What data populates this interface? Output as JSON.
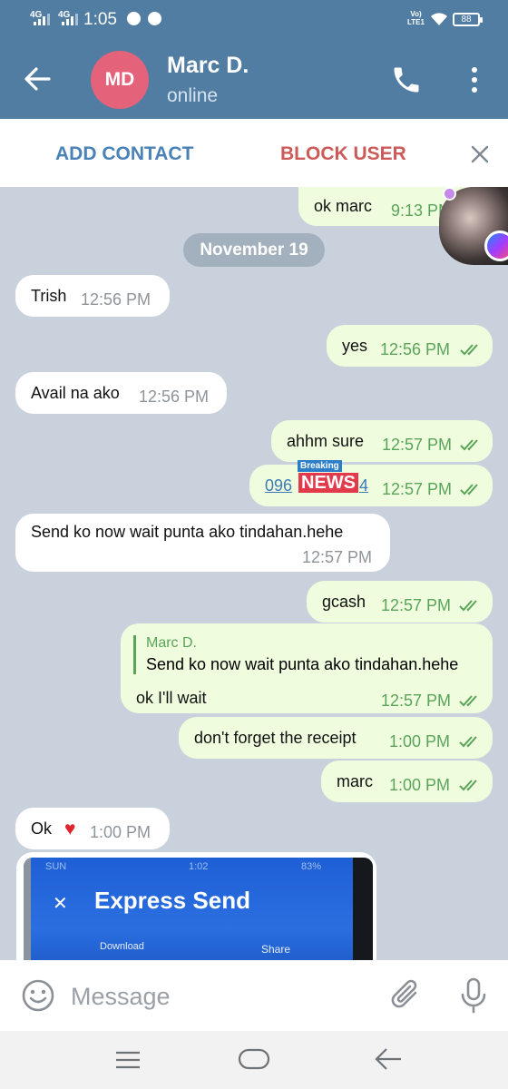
{
  "status_bar": {
    "network_1": "4G",
    "network_2": "4G",
    "time": "1:05",
    "volte": "Vo)",
    "lte": "LTE1",
    "battery": "88"
  },
  "header": {
    "avatar_initials": "MD",
    "avatar_color": "#e4637a",
    "name": "Marc D.",
    "status": "online"
  },
  "action_bar": {
    "add_contact": "ADD CONTACT",
    "block_user": "BLOCK USER"
  },
  "chat": {
    "date_separator": "November 19",
    "messages": [
      {
        "dir": "out",
        "text": "ok marc",
        "time": "9:13 PM"
      },
      {
        "dir": "in",
        "text": "Trish",
        "time": "12:56 PM"
      },
      {
        "dir": "out",
        "text": "yes",
        "time": "12:56 PM"
      },
      {
        "dir": "in",
        "text": "Avail na ako",
        "time": "12:56 PM"
      },
      {
        "dir": "out",
        "text": "ahhm sure",
        "time": "12:57 PM"
      },
      {
        "dir": "out",
        "text_start": "096",
        "text_end": "4",
        "time": "12:57 PM"
      },
      {
        "dir": "in",
        "text": "Send ko now wait punta ako tindahan.hehe",
        "time": "12:57 PM"
      },
      {
        "dir": "out",
        "text": "gcash",
        "time": "12:57 PM"
      },
      {
        "dir": "out",
        "reply_to_name": "Marc D.",
        "reply_to_text": "Send ko now wait punta ako tindahan.hehe",
        "text": "ok I'll wait",
        "time": "12:57 PM"
      },
      {
        "dir": "out",
        "text": "don't forget the receipt",
        "time": "1:00 PM"
      },
      {
        "dir": "out",
        "text": "marc",
        "time": "1:00 PM"
      },
      {
        "dir": "in",
        "text": "Ok",
        "emoji": "♥",
        "time": "1:00 PM"
      }
    ],
    "overlay_sticker": {
      "tag": "Breaking",
      "word": "NEWS"
    },
    "photo": {
      "status_time": "1:02",
      "status_left": "SUN",
      "status_right": "83%",
      "title": "Express Send",
      "download": "Download",
      "share": "Share"
    }
  },
  "input": {
    "placeholder": "Message"
  },
  "colors": {
    "header_bg": "#517da2",
    "chat_bg": "#c9d1dc",
    "outgoing_bubble": "#effdde",
    "incoming_bubble": "#ffffff",
    "read_ticks": "#5aa45a",
    "add_contact": "#4a82b8",
    "block_user": "#cc5a5a"
  },
  "icons": [
    "back-arrow-icon",
    "phone-icon",
    "more-vert-icon",
    "close-icon",
    "emoji-icon",
    "attach-icon",
    "mic-icon",
    "nav-recents-icon",
    "nav-home-icon",
    "nav-back-icon",
    "double-check-icon",
    "heart-icon",
    "messenger-icon"
  ]
}
